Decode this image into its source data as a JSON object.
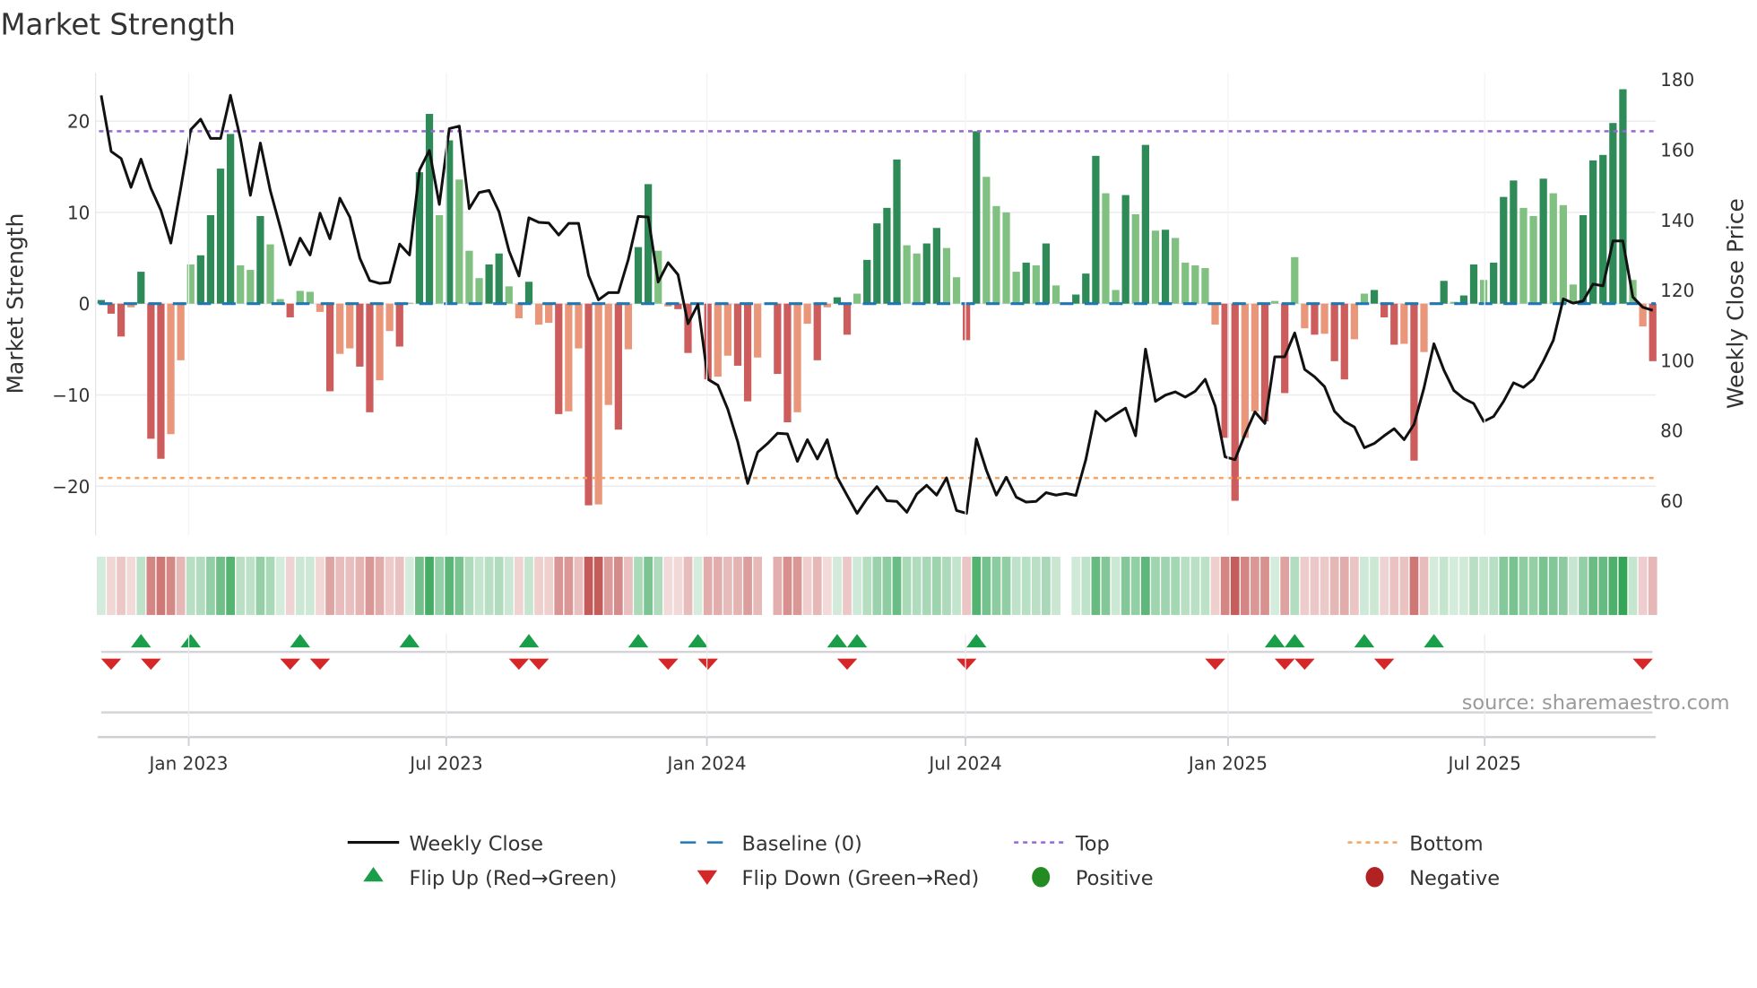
{
  "chart_data": {
    "type": "bar",
    "title": "Market Strength",
    "ylabel": "Market Strength",
    "y2label": "Weekly Close Price",
    "ylim": [
      -25.4,
      25.3
    ],
    "y2lim": [
      50.1,
      181.9
    ],
    "yticks": [
      -20,
      -10,
      0,
      10,
      20
    ],
    "y2ticks": [
      60,
      80,
      100,
      120,
      140,
      160,
      180
    ],
    "grid": true,
    "legend_position": "bottom-center",
    "source": "source: sharemaestro.com",
    "x_ticks": [
      {
        "label": "Jan 2023",
        "week": 8.8
      },
      {
        "label": "Jul 2023",
        "week": 34.7
      },
      {
        "label": "Jan 2024",
        "week": 60.9
      },
      {
        "label": "Jul 2024",
        "week": 86.9
      },
      {
        "label": "Jan 2025",
        "week": 113.3
      },
      {
        "label": "Jul 2025",
        "week": 139.1
      }
    ],
    "thresholds": {
      "top": 18.9,
      "bottom": -19.1,
      "baseline": 0
    },
    "strength": [
      0.4,
      -1.1,
      -3.6,
      -0.4,
      3.5,
      -14.8,
      -17,
      -14.3,
      -6.2,
      4.3,
      5.3,
      9.7,
      14.8,
      18.6,
      4.2,
      3.7,
      9.6,
      6.5,
      0.5,
      -1.5,
      1.4,
      1.3,
      -0.9,
      -9.6,
      -5.5,
      -4.9,
      -6.9,
      -11.9,
      -8.4,
      -3.0,
      -4.7,
      0.1,
      14.4,
      20.8,
      9.7,
      17.9,
      13.6,
      5.8,
      2.8,
      4.3,
      5.5,
      1.9,
      -1.6,
      2.4,
      -2.3,
      -2.1,
      -12.1,
      -11.8,
      -4.9,
      -22.1,
      -22,
      -11.1,
      -13.8,
      -5,
      6.2,
      13.1,
      5.8,
      -0.3,
      -0.6,
      -5.4,
      0.1,
      -8.3,
      -8.0,
      -5.7,
      -6.8,
      -10.7,
      -5.9,
      0,
      -7.7,
      -13,
      -11.9,
      -2.2,
      -6.2,
      -0.4,
      0.7,
      -3.4,
      1.1,
      4.8,
      8.8,
      10.5,
      15.8,
      6.4,
      5.5,
      6.6,
      8.3,
      6.1,
      2.9,
      -4,
      18.9,
      13.9,
      10.7,
      10,
      3.5,
      4.5,
      4.2,
      6.6,
      2,
      0,
      1,
      3.3,
      16.2,
      12.1,
      1.5,
      11.9,
      9.8,
      17.4,
      8,
      8.1,
      7.2,
      4.5,
      4.2,
      3.9,
      -2.3,
      -14.7,
      -21.6,
      -14.7,
      -11.8,
      -12.9,
      0.3,
      -9.8,
      5.1,
      -2.7,
      -3.4,
      -3.3,
      -6.3,
      -8.3,
      -3.9,
      1.1,
      1.5,
      -1.5,
      -4.5,
      -4.4,
      -17.2,
      -5.3,
      0.1,
      2.5,
      0.2,
      0.9,
      4.3,
      2.6,
      4.5,
      11.7,
      13.5,
      10.5,
      9.6,
      13.7,
      12.1,
      10.8,
      2.1,
      9.7,
      15.7,
      16.3,
      19.8,
      23.5,
      2.6,
      -2.5,
      -6.3
    ],
    "weekly_close": [
      175.5,
      159.5,
      157.5,
      149.3,
      157.3,
      149,
      142.7,
      133.4,
      149,
      165.7,
      168.7,
      163.2,
      163.2,
      175.5,
      163.2,
      147,
      161.9,
      148.3,
      138,
      127.2,
      134.8,
      130,
      141.9,
      134.6,
      146.2,
      140.8,
      129.1,
      122.7,
      121.9,
      122.2,
      133.1,
      130,
      154.2,
      159.8,
      144.4,
      166,
      166.7,
      143.2,
      147.8,
      148.4,
      142.3,
      131.2,
      124,
      140.6,
      139.3,
      139.1,
      135.7,
      139,
      139,
      124.2,
      117.2,
      119.3,
      119.3,
      128.7,
      141,
      140.8,
      122.3,
      127.8,
      124.4,
      110.4,
      115.9,
      94.6,
      92.9,
      86.1,
      76.8,
      64.9,
      73.8,
      76.3,
      79.2,
      79,
      71.2,
      77.4,
      71.9,
      77.4,
      66.7,
      61.5,
      56.4,
      60.6,
      64,
      60,
      59.8,
      56.7,
      61.9,
      64.4,
      61.6,
      66.5,
      57.2,
      56.4,
      77.6,
      68.7,
      61.6,
      66.7,
      61,
      59.6,
      59.8,
      62.3,
      61.6,
      62.1,
      61.5,
      71.7,
      85.5,
      82.7,
      84.6,
      86.4,
      78.5,
      103.2,
      88.3,
      90.1,
      91,
      89.5,
      91.2,
      94.6,
      87,
      72.5,
      71.7,
      78.9,
      85.3,
      82,
      101,
      101,
      107.8,
      97.4,
      95.3,
      92.5,
      85.5,
      82.6,
      81,
      75.1,
      76.3,
      78.5,
      80.5,
      77.4,
      81.8,
      92.1,
      104.7,
      97.2,
      91.4,
      89.1,
      87.7,
      82.6,
      84,
      88.3,
      93.6,
      92.3,
      94.6,
      99.8,
      105.7,
      117.5,
      116.3,
      116.9,
      121.7,
      121.2,
      134,
      134,
      118,
      115.1,
      114.2
    ],
    "legend": [
      {
        "key": "close",
        "label": "Weekly Close"
      },
      {
        "key": "baseline",
        "label": "Baseline (0)"
      },
      {
        "key": "top",
        "label": "Top"
      },
      {
        "key": "bottom",
        "label": "Bottom"
      },
      {
        "key": "flip_up",
        "label": "Flip Up (Red→Green)"
      },
      {
        "key": "flip_down",
        "label": "Flip Down (Green→Red)"
      },
      {
        "key": "positive",
        "label": "Positive"
      },
      {
        "key": "negative",
        "label": "Negative"
      }
    ],
    "colors": {
      "pos_strong": "#2e8b57",
      "pos_weak": "#80c080",
      "neg_strong": "#cd5c5c",
      "neg_weak": "#e9967a",
      "close": "#111111",
      "baseline": "#1f77b4",
      "top": "#9467d8",
      "bottom": "#f4a460",
      "flip_up": "#1a9e4a",
      "flip_down": "#d62728",
      "positive": "#228b22",
      "negative": "#b22222",
      "heat_pos": "#31a354",
      "heat_neg": "#c0504d"
    }
  }
}
